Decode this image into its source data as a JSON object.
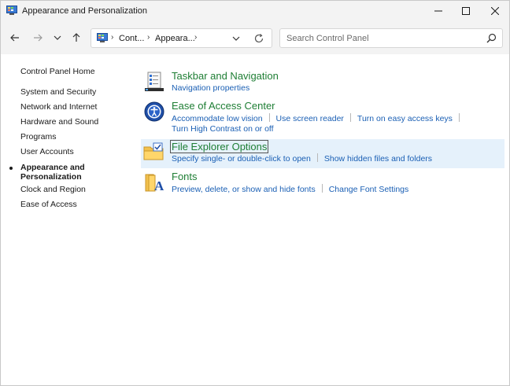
{
  "window": {
    "title": "Appearance and Personalization"
  },
  "nav": {
    "breadcrumbs": [
      "Cont...",
      "Appeara..."
    ],
    "search_placeholder": "Search Control Panel"
  },
  "sidebar": {
    "home": "Control Panel Home",
    "items": [
      "System and Security",
      "Network and Internet",
      "Hardware and Sound",
      "Programs",
      "User Accounts",
      "Appearance and Personalization",
      "Clock and Region",
      "Ease of Access"
    ],
    "current_line1": "Appearance and",
    "current_line2": "Personalization"
  },
  "categories": {
    "taskbar": {
      "title": "Taskbar and Navigation",
      "links": [
        "Navigation properties"
      ]
    },
    "ease": {
      "title": "Ease of Access Center",
      "links": [
        "Accommodate low vision",
        "Use screen reader",
        "Turn on easy access keys",
        "Turn High Contrast on or off"
      ]
    },
    "explorer": {
      "title": "File Explorer Options",
      "links": [
        "Specify single- or double-click to open",
        "Show hidden files and folders"
      ]
    },
    "fonts": {
      "title": "Fonts",
      "links": [
        "Preview, delete, or show and hide fonts",
        "Change Font Settings"
      ]
    }
  },
  "colors": {
    "category_title": "#1e7e34",
    "link": "#1a5fb4",
    "selected_background": "#e5f1fb",
    "chrome": "#f3f3f3"
  },
  "icons": {
    "app": "control-panel-icon",
    "taskbar": "taskbar-icon",
    "ease": "ease-of-access-icon",
    "explorer": "folder-options-icon",
    "fonts": "fonts-icon"
  }
}
